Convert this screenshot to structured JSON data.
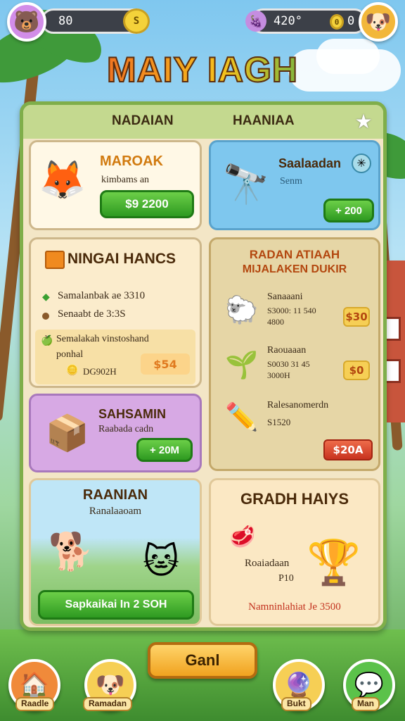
{
  "topbar": {
    "left_value": "80",
    "right_value": "420°",
    "right_suffix": "0",
    "left_coin": "S"
  },
  "title": "MAIY IAGH",
  "tabs": [
    "NADAIAN",
    "HAANIAA"
  ],
  "cards": {
    "marak": {
      "title": "MAROAK",
      "subtitle": "kimbams an",
      "button": "$9 2200"
    },
    "saal": {
      "title": "Saalaadan",
      "subtitle": "Senm",
      "button": "+ 200"
    },
    "ningai": {
      "title": "NINGAI HANCS",
      "line1": "Samalanbak ae 3310",
      "line2": "Senaabt de 3:3S",
      "highlight_line1": "Semalakah vinstoshand",
      "highlight_line2": "ponhal",
      "highlight_code": "DG902H",
      "highlight_price": "$54"
    },
    "radan": {
      "title_line1": "RADAN ATIAAH",
      "title_line2": "MIJALAKEN DUKIR",
      "items": [
        {
          "name": "Sanaaani",
          "line1": "S3000: 11 540",
          "line2": "4800",
          "price": "$30"
        },
        {
          "name": "Raouaaan",
          "line1": "S0030 31 45",
          "line2": "3000H",
          "price": "$0"
        },
        {
          "name": "Ralesanomerdn",
          "line1": "S1520",
          "line2": "",
          "price": "$20A"
        }
      ]
    },
    "sahsamin": {
      "title": "SAHSAMIN",
      "subtitle": "Raabada cadn",
      "button": "+ 20M"
    },
    "raanian": {
      "title": "RAANIAN",
      "subtitle": "Ranalaaoam",
      "button": "Sapkaikai In 2 SOH"
    },
    "gradh": {
      "title": "GRADH HAIYS",
      "label1": "Roaiadaan",
      "label2": "P10",
      "footer": "Namninlahiat Je 3500"
    }
  },
  "center_button": "Ganl",
  "nav": [
    {
      "label": "Raadle",
      "icon": "home-icon"
    },
    {
      "label": "Ramadan",
      "icon": "pet-icon"
    },
    {
      "label": "Bukt",
      "icon": "magic-orb-icon"
    },
    {
      "label": "Man",
      "icon": "chat-icon"
    }
  ]
}
